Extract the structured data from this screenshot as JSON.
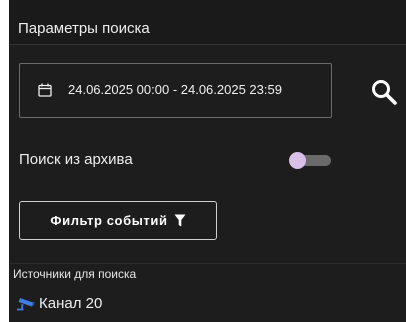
{
  "panel": {
    "title": "Параметры поиска"
  },
  "date_range": {
    "value": "24.06.2025 00:00 - 24.06.2025 23:59",
    "icon": "calendar-icon"
  },
  "search": {
    "icon": "search-icon"
  },
  "archive": {
    "label": "Поиск из архива",
    "enabled": false
  },
  "filter": {
    "label": "Фильтр событий",
    "icon": "funnel-icon"
  },
  "sources": {
    "title": "Источники для поиска",
    "items": [
      {
        "label": "Канал 20",
        "icon": "camera-icon",
        "icon_color": "#3f7de0"
      }
    ]
  },
  "colors": {
    "panel_background": "#1d1d1d",
    "toggle_knob": "#d8c0e8",
    "toggle_track": "#6a6a6a"
  }
}
